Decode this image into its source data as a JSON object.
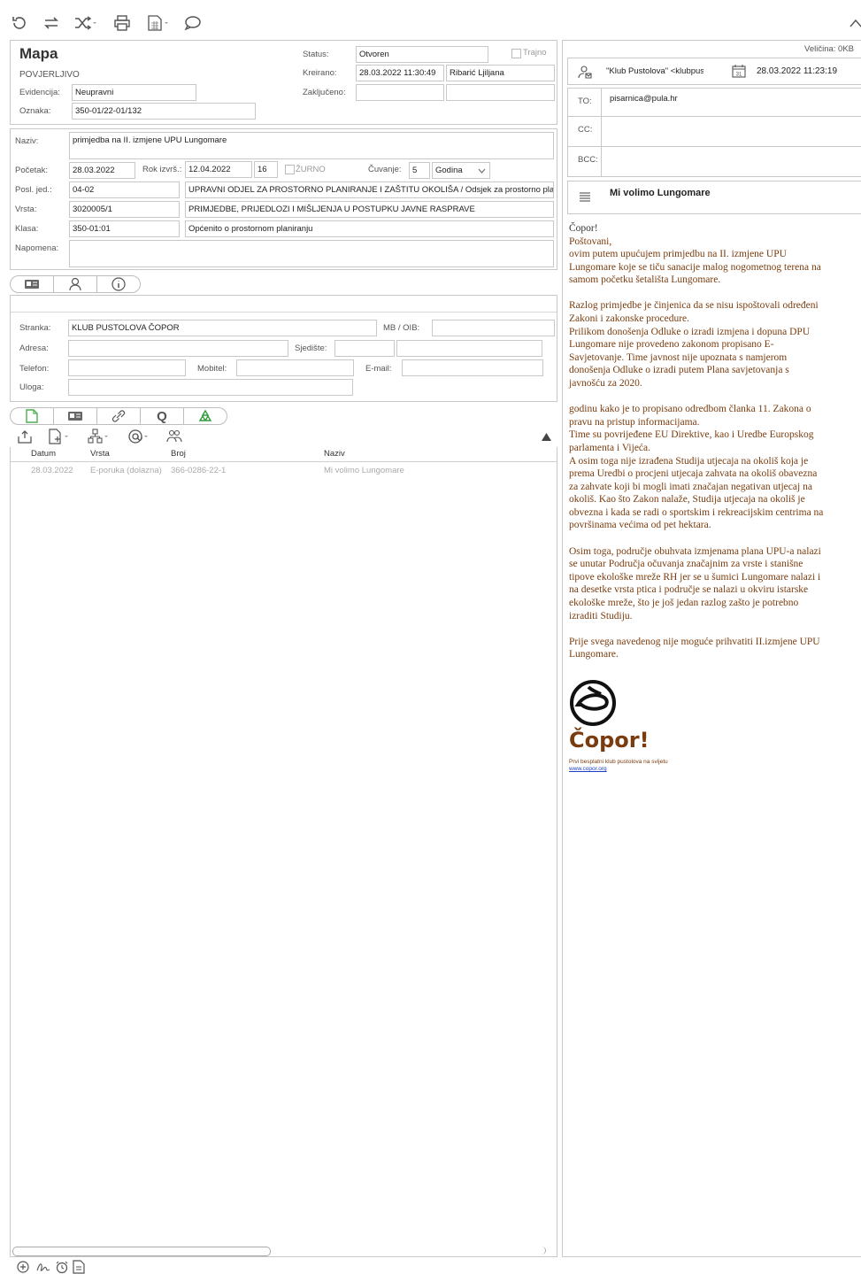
{
  "colors": {
    "accent_green": "#4caf50",
    "brown_text": "#7a3c0e",
    "border": "#c8c8c8"
  },
  "toolbar": {
    "icons": [
      "history-icon",
      "transfer-icon",
      "shuffle-icon",
      "print-icon",
      "table-icon",
      "comment-icon"
    ]
  },
  "case": {
    "title": "Mapa",
    "classification": "POVJERLJIVO",
    "evidencija_label": "Evidencija:",
    "evidencija_value": "Neupravni",
    "oznaka_label": "Oznaka:",
    "oznaka_value": "350-01/22-01/132",
    "status_label": "Status:",
    "status_value": "Otvoren",
    "trajno_label": "Trajno",
    "kreirano_label": "Kreirano:",
    "kreirano_value": "28.03.2022 11:30:49",
    "kreirano_user": "Ribarić Ljiljana",
    "zakljuceno_label": "Zaključeno:"
  },
  "details": {
    "naziv_label": "Naziv:",
    "naziv_value": "primjedba na II. izmjene UPU Lungomare",
    "pocetak_label": "Početak:",
    "pocetak_value": "28.03.2022",
    "rok_label": "Rok izvrš.:",
    "rok_value": "12.04.2022",
    "rok_days": "16",
    "zurno_label": "ŽURNO",
    "cuvanje_label": "Čuvanje:",
    "cuvanje_value": "5",
    "cuvanje_unit": "Godina",
    "posl_label": "Posl. jed.:",
    "posl_code": "04-02",
    "posl_name": "UPRAVNI ODJEL ZA PROSTORNO PLANIRANJE I ZAŠTITU OKOLIŠA / Odsjek za prostorno planiranje",
    "vrsta_label": "Vrsta:",
    "vrsta_code": "3020005/1",
    "vrsta_name": "PRIMJEDBE, PRIJEDLOZI I MIŠLJENJA U POSTUPKU JAVNE RASPRAVE",
    "klasa_label": "Klasa:",
    "klasa_code": "350-01:01",
    "klasa_name": "Općenito o prostornom planiranju",
    "napomena_label": "Napomena:"
  },
  "party": {
    "stranka_label": "Stranka:",
    "stranka_value": "KLUB PUSTOLOVA ČOPOR",
    "mb_label": "MB / OIB:",
    "adresa_label": "Adresa:",
    "sjediste_label": "Sjedište:",
    "telefon_label": "Telefon:",
    "mobitel_label": "Mobitel:",
    "email_label": "E-mail:",
    "uloga_label": "Uloga:"
  },
  "documents": {
    "columns": [
      "Datum",
      "Vrsta",
      "Broj",
      "Naziv"
    ],
    "rows": [
      {
        "datum": "28.03.2022",
        "vrsta": "E-poruka (dolazna)",
        "broj": "366-0286-22-1",
        "naziv": "Mi volimo Lungomare"
      }
    ]
  },
  "email": {
    "size": "Veličina: 0KB",
    "from": "\"Klub Pustolova\" <klubpustolova@copor.org>",
    "date": "28.03.2022 11:23:19",
    "to_label": "TO:",
    "to_value": "pisarnica@pula.hr",
    "cc_label": "CC:",
    "bcc_label": "BCC:",
    "subject": "Mi volimo Lungomare",
    "body_lines_p1": [
      "Čopor!",
      "Poštovani,",
      "ovim putem upućujem primjedbu na II. izmjene UPU",
      "Lungomare koje se tiču sanacije malog nogometnog terena na",
      "samom početku šetališta Lungomare."
    ],
    "body_lines_p2": [
      "Razlog primjedbe je činjenica da se nisu ispoštovali određeni",
      "Zakoni i zakonske procedure.",
      "Prilikom donošenja Odluke o izradi izmjena i dopuna DPU",
      "Lungomare nije provedeno zakonom propisano E-",
      "Savjetovanje. Time javnost nije upoznata s namjerom",
      "donošenja Odluke o izradi putem Plana savjetovanja s",
      "javnošću za 2020."
    ],
    "body_lines_p3": [
      "godinu kako je to propisano odredbom članka 11. Zakona o",
      "pravu na pristup informacijama.",
      "Time su povrijeđene EU Direktive, kao i Uredbe Europskog",
      "parlamenta i Vijeća.",
      "A osim toga nije izrađena Studija utjecaja na okoliš koja je",
      "prema Uredbi o procjeni utjecaja zahvata na okoliš obavezna",
      "za zahvate koji bi mogli imati značajan negativan utjecaj na",
      "okoliš. Kao što Zakon nalaže, Studija utjecaja na okoliš je",
      "obvezna i kada se radi o sportskim i rekreacijskim centrima na",
      "površinama većima od pet hektara."
    ],
    "body_lines_p4": [
      "Osim toga, područje obuhvata izmjenama plana UPU-a nalazi",
      "se unutar Područja očuvanja značajnim za vrste i stanišne",
      "tipove ekološke mreže RH jer se u šumici Lungomare nalazi i",
      "na desetke vrsta ptica i područje se nalazi u okviru istarske",
      "ekološke mreže, što je još jedan razlog zašto je potrebno",
      "izraditi Studiju."
    ],
    "body_lines_p5": [
      "Prije svega navedenog nije moguće prihvatiti II.izmjene UPU",
      "Lungomare."
    ],
    "signature_name": "Čopor!",
    "signature_tagline": "Prvi besplatni klub pustolova na svijetu",
    "signature_url": "www.copor.org"
  }
}
